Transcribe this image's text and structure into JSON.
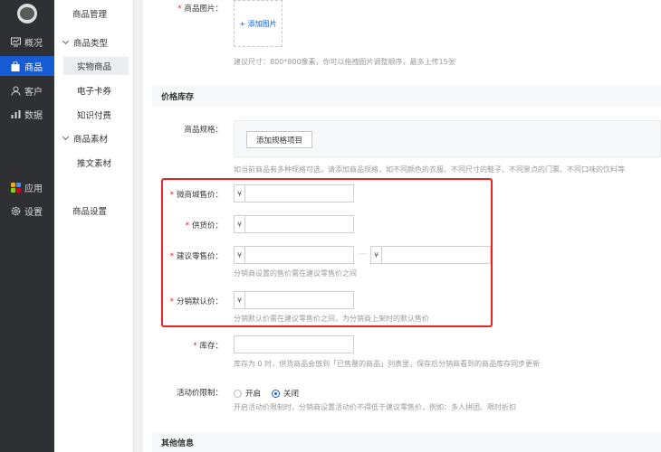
{
  "sidebar": {
    "items": [
      {
        "label": "概况",
        "icon": "overview-icon"
      },
      {
        "label": "商品",
        "icon": "goods-icon"
      },
      {
        "label": "客户",
        "icon": "customer-icon"
      },
      {
        "label": "数据",
        "icon": "data-icon"
      },
      {
        "label": "应用",
        "icon": "apps-icon"
      },
      {
        "label": "设置",
        "icon": "settings-icon"
      }
    ],
    "active_color": "#155bd4"
  },
  "subnav": {
    "goods_manage": "商品管理",
    "goods_type": "商品类型",
    "physical": "实物商品",
    "ecard": "电子卡券",
    "knowledge": "知识付费",
    "material": "商品素材",
    "promo": "推文素材",
    "goods_settings": "商品设置"
  },
  "form": {
    "image": {
      "label": "商品图片：",
      "add": "+ 添加图片",
      "hint": "建议尺寸：800*800像素，你可以拖拽图片调整顺序，最多上传15张"
    },
    "price_section": "价格库存",
    "spec": {
      "label": "商品规格：",
      "button": "添加规格项目",
      "hint": "如当前商品有多种规格可选，请添加商品规格，如不同颜色的衣服、不同尺寸的鞋子、不同景点的门票、不同口味的饮料等"
    },
    "currency": "¥",
    "micro_price": {
      "label": "微商城售价："
    },
    "supply_price": {
      "label": "供货价："
    },
    "retail_price": {
      "label": "建议零售价：",
      "sep": "—",
      "hint": "分销商设置的售价需在建议零售价之间"
    },
    "default_dist_price": {
      "label": "分销默认价：",
      "hint": "分销默认价需在建议零售价之间，为分销商上架时的默认售价"
    },
    "stock": {
      "label": "库存：",
      "hint": "库存为 0 时，供货商品会放到「已售罄的商品」列表里，保存后分销商看到的商品库存同步更新"
    },
    "activity": {
      "label": "活动价限制：",
      "on": "开启",
      "off": "关闭",
      "hint": "开启活动价限制时，分销商设置活动价不得低于建议零售价，例如：多人拼团、限时折扣"
    },
    "other_section": "其他信息"
  },
  "highlight_color": "#e82323"
}
